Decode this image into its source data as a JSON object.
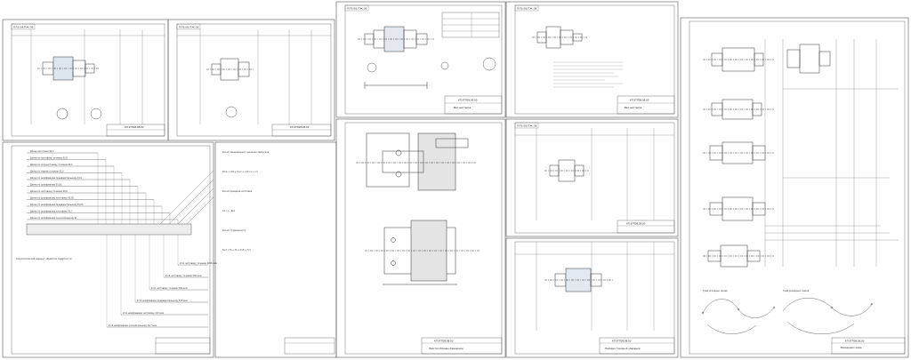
{
  "sheets": [
    {
      "id": "sheet-1",
      "top_code": "ПЛЗ.08.ПЖ.08",
      "title_line": "",
      "stamp_code": "КП.9ТП08.08.00"
    },
    {
      "id": "sheet-2",
      "top_code": "ПЛЗ.08.ПЖ.08",
      "title_line": "",
      "stamp_code": "КП.9ТП08.08.00"
    },
    {
      "id": "sheet-3",
      "top_code": "ПЛЗ.08.ПЖ.08",
      "title_line": "Вал-шестерня",
      "stamp_code": "КП.9ТП08.08.00"
    },
    {
      "id": "sheet-4",
      "top_code": "ПЛЗ.08.ПЖ.08",
      "title_line": "Вал-шестерня",
      "stamp_code": "КП.9ТП08.08.00"
    },
    {
      "id": "sheet-5",
      "top_code": "",
      "title_line": "Приспособление фрезерное",
      "stamp_code": "КП.9ТП08.08.00"
    },
    {
      "id": "sheet-6",
      "top_code": "ПЛЗ.08.ПЖ.08",
      "title_line": "",
      "stamp_code": "КП.9ТП08.08.00"
    },
    {
      "id": "sheet-7",
      "top_code": "",
      "title_line": "Наладка токарной операции",
      "stamp_code": "КП.9ТП08.08.00"
    },
    {
      "id": "sheet-8",
      "top_code": "",
      "title_line": "Размерная схема",
      "stamp_code": "КП.9ТП08.08.00"
    }
  ],
  "allowance_diagram": {
    "left_labels": [
      "Длина заготовки 94,3",
      "Длина по чистовому точению 92,8",
      "Длина по получистовому точению 92,4",
      "Длина по чернов точению 92,0",
      "Длина по шлифованию предварительному 91,9",
      "Длина по шлифованию 91,85",
      "Длина по чистовому точению 90,0",
      "Длина по шлифованию чистовому 90,05",
      "Длина по шлифованию предварительному 91,05",
      "Длина по шлифованию чистовому 91,7",
      "Длина по шлифованию окончательному 91"
    ],
    "right_labels": [
      "Z по чистовому точению 4200 мкм",
      "Z по чистовому точению 540 мкм",
      "Z по чистовому точению 390 мкм",
      "Z по шлифованию предварительному 325 мкм",
      "Z по шлифованию чистовому 210 мкм",
      "Z по шлифованию окончательному 16,7 мкм"
    ],
    "note": "Технологический маршрут обработки поверхности"
  },
  "calc_text": {
    "lines": [
      "Расчет минимального значения припусков",
      "Zmin = (Rz + h)i-1 + √(Δ²i-1 + ε²i)",
      "Расчет размеров заготовки",
      "Ld = L - ΔLd",
      "Расчет трудоемкости",
      "Tшт = To + Tв + Tоб + Tот"
    ]
  },
  "stamp": {
    "fields": [
      "Изм.",
      "Лист",
      "№ докум.",
      "Подп.",
      "Дата"
    ],
    "org": "УГАТУ"
  },
  "sketch_titles": [
    "Граф исходных связей",
    "Граф размерных связей"
  ]
}
